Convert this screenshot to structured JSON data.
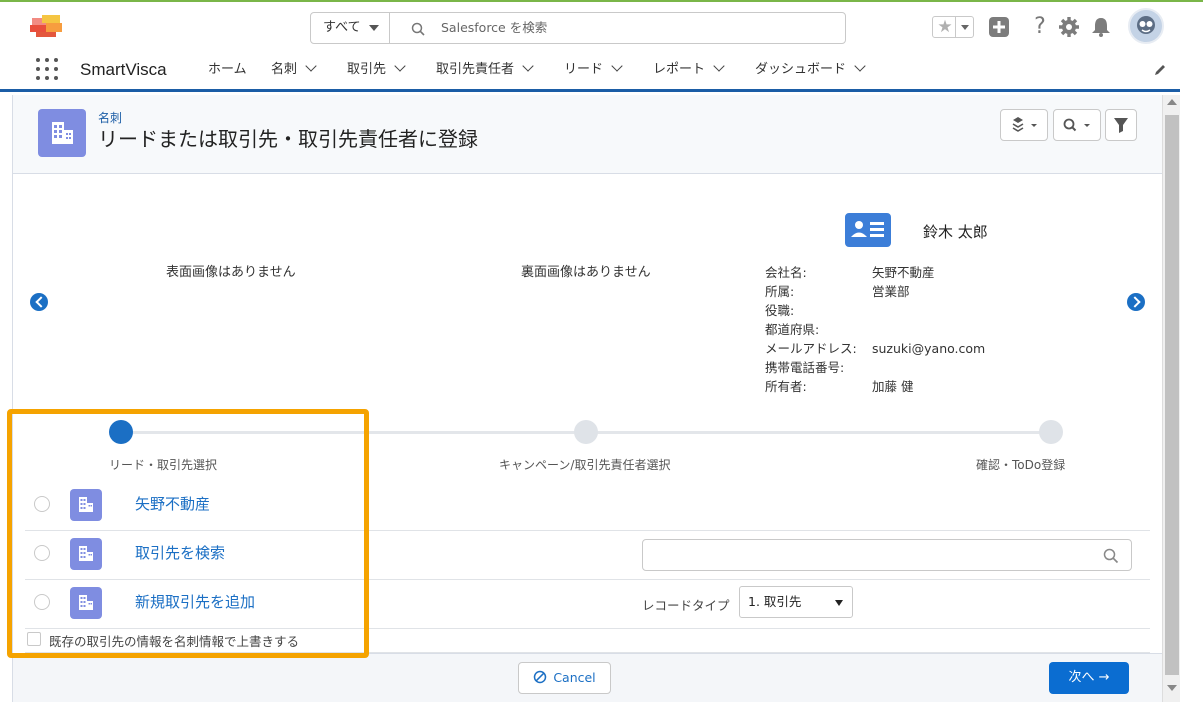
{
  "header": {
    "search_scope": "すべて",
    "search_placeholder": "Salesforce を検索"
  },
  "app": {
    "name": "SmartVisca",
    "nav": [
      {
        "label": "ホーム",
        "dropdown": false
      },
      {
        "label": "名刺",
        "dropdown": true
      },
      {
        "label": "取引先",
        "dropdown": true
      },
      {
        "label": "取引先責任者",
        "dropdown": true
      },
      {
        "label": "リード",
        "dropdown": true
      },
      {
        "label": "レポート",
        "dropdown": true
      },
      {
        "label": "ダッシュボード",
        "dropdown": true
      }
    ]
  },
  "page": {
    "eyebrow": "名刺",
    "title": "リードまたは取引先・取引先責任者に登録"
  },
  "card": {
    "front_no_image": "表面画像はありません",
    "back_no_image": "裏面画像はありません",
    "name": "鈴木 太郎",
    "details": [
      {
        "label": "会社名:",
        "value": "矢野不動産"
      },
      {
        "label": "所属:",
        "value": "営業部"
      },
      {
        "label": "役職:",
        "value": ""
      },
      {
        "label": "都道府県:",
        "value": ""
      },
      {
        "label": "メールアドレス:",
        "value": "suzuki@yano.com"
      },
      {
        "label": "携帯電話番号:",
        "value": ""
      },
      {
        "label": "所有者:",
        "value": "加藤 健"
      }
    ]
  },
  "steps": [
    {
      "label": "リード・取引先選択",
      "active": true
    },
    {
      "label": "キャンペーン/取引先責任者選択",
      "active": false
    },
    {
      "label": "確認・ToDo登録",
      "active": false
    }
  ],
  "options": {
    "existing_account": "矢野不動産",
    "search_account": "取引先を検索",
    "new_account": "新規取引先を追加",
    "record_type_label": "レコードタイプ",
    "record_type_value": "1. 取引先",
    "overwrite_label": "既存の取引先の情報を名刺情報で上書きする"
  },
  "footer": {
    "cancel": "Cancel",
    "next": "次へ →"
  },
  "colors": {
    "brand_blue": "#0b6dd1",
    "link_blue": "#1b6fc4",
    "highlight_orange": "#f5a300",
    "object_icon": "#7f8de1"
  }
}
